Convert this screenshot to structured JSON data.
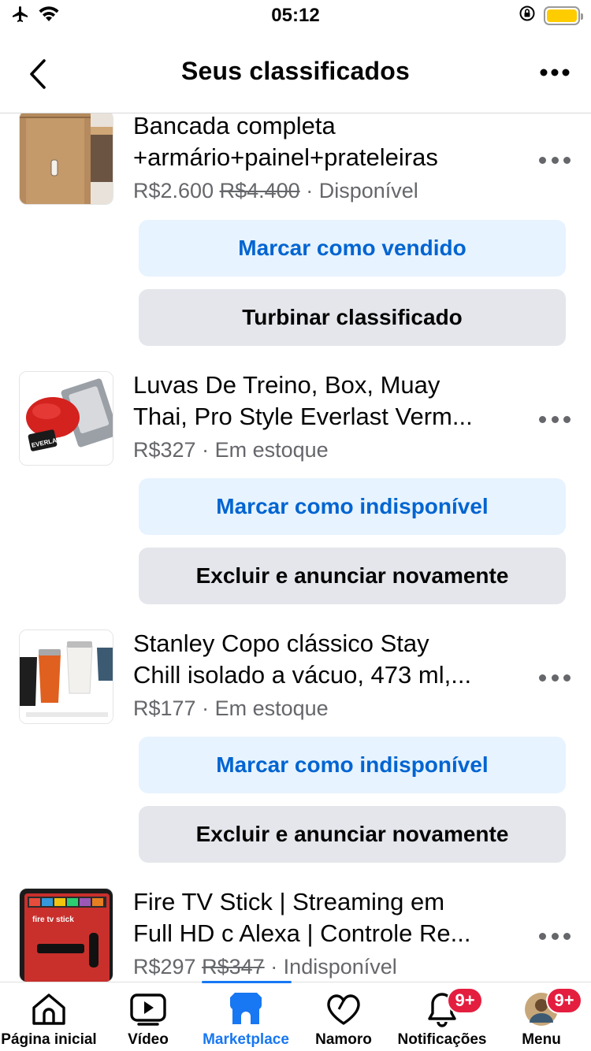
{
  "status_bar": {
    "time": "05:12"
  },
  "header": {
    "title": "Seus classificados"
  },
  "listings": [
    {
      "title_line1": "Bancada completa",
      "title_line2": "+armário+painel+prateleiras",
      "price": "R$2.600",
      "old_price": "R$4.400",
      "status": "· Disponível",
      "primary_action": "Marcar como vendido",
      "secondary_action": "Turbinar classificado",
      "thumbnail_icon": "wood-cabinet-photo"
    },
    {
      "title_line1": "Luvas De Treino, Box, Muay",
      "title_line2": "Thai, Pro Style Everlast Verm...",
      "price": "R$327",
      "old_price": "",
      "status": "· Em estoque",
      "primary_action": "Marcar como indisponível",
      "secondary_action": "Excluir e anunciar novamente",
      "thumbnail_icon": "boxing-gloves-photo",
      "thumbnail_text": "EVERLAST"
    },
    {
      "title_line1": "Stanley Copo clássico Stay",
      "title_line2": "Chill isolado a vácuo, 473 ml,...",
      "price": "R$177",
      "old_price": "",
      "status": "· Em estoque",
      "primary_action": "Marcar como indisponível",
      "secondary_action": "Excluir e anunciar novamente",
      "thumbnail_icon": "tumbler-cups-photo"
    },
    {
      "title_line1": "Fire TV Stick | Streaming em",
      "title_line2": "Full HD c Alexa | Controle Re...",
      "price": "R$297",
      "old_price": "R$347",
      "status": "· Indisponível",
      "thumbnail_icon": "fire-tv-box-photo",
      "thumbnail_text": "fire tv stick"
    }
  ],
  "tabbar": {
    "tabs": [
      {
        "label": "Página inicial",
        "icon": "home-icon"
      },
      {
        "label": "Vídeo",
        "icon": "video-icon"
      },
      {
        "label": "Marketplace",
        "icon": "marketplace-icon",
        "active": true
      },
      {
        "label": "Namoro",
        "icon": "heart-icon"
      },
      {
        "label": "Notificações",
        "icon": "bell-icon",
        "badge": "9+"
      },
      {
        "label": "Menu",
        "icon": "avatar",
        "badge": "9+"
      }
    ]
  },
  "colors": {
    "accent": "#1877f2",
    "primary_button_bg": "#e7f3ff",
    "primary_button_text": "#0064d1",
    "secondary_button_bg": "#e4e6eb",
    "badge": "#e41e3f",
    "battery": "#ffcc00"
  }
}
